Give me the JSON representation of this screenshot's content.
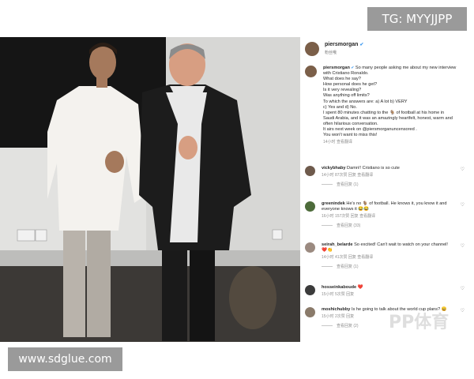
{
  "watermarks": {
    "top": "TG: MYYJJPP",
    "bottom": "www.sdglue.com",
    "logo": "PP体育"
  },
  "post": {
    "username": "piersmorgan",
    "verified_icon": "verified-badge-icon",
    "header_sub": "粉丝哦",
    "caption_lines": [
      "So many people asking me about my new interview",
      "with Cristiano Ronaldo.",
      "What does he say?",
      "How personal does he get?",
      "Is it very revealing?",
      "Was anything off limits?",
      "To which the answers are: a) A lot b) VERY",
      "c) Yes and d) No.",
      "I spent 80 minutes chatting to the 🐐 of football at his home in",
      "Saudi Arabia, and it was an amazingly heartfelt, honest, warm and",
      "often hilarious conversation.",
      "It airs next week on @piersmorganuncensored .",
      "You won't want to miss this!"
    ],
    "caption_meta": "14小时  查看翻译"
  },
  "comments": [
    {
      "username": "vickybhaby",
      "text": "Damn!! Cristiano is so cute",
      "meta": "14小时  87次赞  回复  查看翻译",
      "replies": "查看回复 (1)",
      "avatar_color": "#6e5a4c"
    },
    {
      "username": "greenindek",
      "text": "He's no 🐐 of football. He knows it, you know it and everyone knows it 😂😂",
      "meta": "16小时  157次赞  回复  查看翻译",
      "replies": "查看回复 (33)",
      "avatar_color": "#4d6b3a"
    },
    {
      "username": "seirah_belarde",
      "text": "So excited! Can't wait to watch on your channel! ❤️👏",
      "meta": "14小时  41次赞  回复  查看翻译",
      "replies": "查看回复 (1)",
      "avatar_color": "#9b8a80"
    },
    {
      "username": "hosseinkaboude",
      "text": "❤️",
      "meta": "15小时  5次赞  回复",
      "replies": "",
      "avatar_color": "#3b3b3b"
    },
    {
      "username": "moshichubby",
      "text": "Is he going to talk about the world cup plans? 😀",
      "meta": "15小时  2次赞  回复",
      "replies": "查看回复 (2)",
      "avatar_color": "#8a7a6a"
    }
  ],
  "icons": {
    "like": "heart-icon"
  }
}
